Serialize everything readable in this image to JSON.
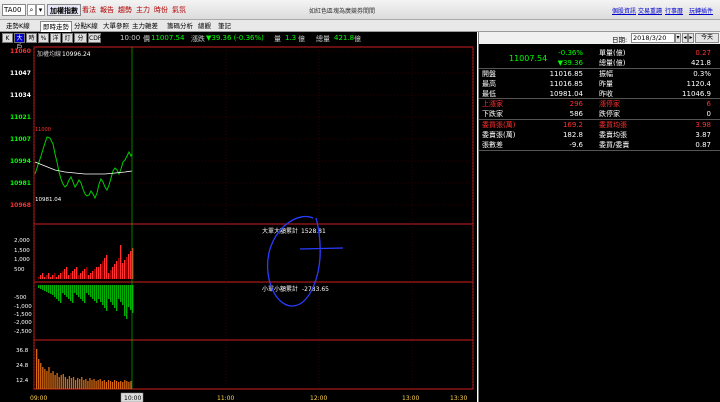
{
  "topbar": {
    "code": "TA00",
    "menu": [
      "加權指數",
      "看法",
      "報告",
      "趨勢",
      "主力",
      "時份",
      "氣氛"
    ],
    "title": "如紅色區塊為廣競券間間",
    "links": [
      "個股資訊",
      "交易重讀",
      "行事曆",
      "玩轉插件"
    ]
  },
  "tabs": [
    "走勢K線",
    "即時走勢",
    "分點K線",
    "大單參照",
    "主力雜差",
    "籌碼分析",
    "總觀",
    "筆記"
  ],
  "toolbar": {
    "buttons": [
      "K線",
      "大戶",
      "時",
      "%",
      "洋",
      "灯",
      "分例",
      "CDP"
    ],
    "time": "10:00",
    "quote": {
      "price_label": "價",
      "price": "11007.54",
      "change_label": "漲跌",
      "change": "▼39.36 (-0.36%)",
      "vol_label": "量",
      "vol": "1.3",
      "vol_unit": "億",
      "total_label": "總量",
      "total": "421.8",
      "total_unit": "億"
    }
  },
  "chart": {
    "title": "加權均線",
    "title_value": "10996.24",
    "price_ticks": [
      "11060",
      "11047",
      "11034",
      "11021",
      "11007",
      "10994",
      "10981",
      "10968"
    ],
    "current_price_label": "11000",
    "low_label": "10981.04",
    "big_order_label": "大單大額累計",
    "big_order_value": "1528.81",
    "small_order_label": "小單小額累計",
    "small_order_value": "-2783.65",
    "upper_ticks": [
      "2,000",
      "1,500",
      "1,000",
      "500"
    ],
    "lower_ticks": [
      "-500",
      "-1,000",
      "-1,500",
      "-2,000",
      "-2,500"
    ],
    "vol_ticks": [
      "36.8",
      "24.8",
      "12.4"
    ],
    "time_ticks": [
      "09:00",
      "10:00",
      "11:00",
      "12:00",
      "13:00",
      "13:30"
    ],
    "cursor_time": "10:00",
    "colors": {
      "up": "#ff3030",
      "down": "#00c000",
      "avg": "#ffffff",
      "grid": "#7a0000",
      "axis": "#ff2020"
    }
  },
  "right_panel": {
    "date_label": "日期:",
    "date_value": "2018/3/20",
    "today_label": "今天",
    "big_price": "11007.54",
    "rows": [
      {
        "cells": [
          {
            "t": "-0.36%",
            "c": "#00ff00"
          },
          {
            "t": "單量(億)",
            "c": "#ffffff"
          },
          {
            "t": "0.27",
            "c": "#ff3030"
          }
        ]
      },
      {
        "cells": [
          {
            "t": "▼39.36",
            "c": "#00ff00"
          },
          {
            "t": "總量(億)",
            "c": "#ffffff"
          },
          {
            "t": "421.8",
            "c": "#ffffff"
          }
        ]
      },
      {
        "cells": [
          {
            "t": "開盤",
            "c": "#ffffff"
          },
          {
            "t": "11016.85",
            "c": "#ffffff"
          },
          {
            "t": "振幅",
            "c": "#ffffff"
          },
          {
            "t": "0.3%",
            "c": "#ffffff"
          }
        ]
      },
      {
        "cells": [
          {
            "t": "最高",
            "c": "#ffffff"
          },
          {
            "t": "11016.85",
            "c": "#ffffff"
          },
          {
            "t": "昨量",
            "c": "#ffffff"
          },
          {
            "t": "1120.4",
            "c": "#ffffff"
          }
        ]
      },
      {
        "cells": [
          {
            "t": "最低",
            "c": "#ffffff"
          },
          {
            "t": "10981.04",
            "c": "#ffffff"
          },
          {
            "t": "昨收",
            "c": "#ffffff"
          },
          {
            "t": "11046.9",
            "c": "#ffffff"
          }
        ]
      },
      {
        "cells": [
          {
            "t": "上漲家",
            "c": "#ff3030"
          },
          {
            "t": "296",
            "c": "#ff3030"
          },
          {
            "t": "漲停家",
            "c": "#ff3030"
          },
          {
            "t": "6",
            "c": "#ff3030"
          }
        ]
      },
      {
        "cells": [
          {
            "t": "下跌家",
            "c": "#ffffff"
          },
          {
            "t": "586",
            "c": "#ffffff"
          },
          {
            "t": "跌停家",
            "c": "#ffffff"
          },
          {
            "t": "0",
            "c": "#ffffff"
          }
        ]
      },
      {
        "cells": [
          {
            "t": "委買張(萬)",
            "c": "#ff3030"
          },
          {
            "t": "169.2",
            "c": "#ff3030"
          },
          {
            "t": "委買均張",
            "c": "#ff3030"
          },
          {
            "t": "3.98",
            "c": "#ff3030"
          }
        ]
      },
      {
        "cells": [
          {
            "t": "委賣張(萬)",
            "c": "#ffffff"
          },
          {
            "t": "182.8",
            "c": "#ffffff"
          },
          {
            "t": "委賣均張",
            "c": "#ffffff"
          },
          {
            "t": "3.87",
            "c": "#ffffff"
          }
        ]
      },
      {
        "cells": [
          {
            "t": "張數差",
            "c": "#ffffff"
          },
          {
            "t": "-9.6",
            "c": "#ffffff"
          },
          {
            "t": "委買/委賣",
            "c": "#ffffff"
          },
          {
            "t": "0.87",
            "c": "#ffffff"
          }
        ]
      }
    ]
  }
}
